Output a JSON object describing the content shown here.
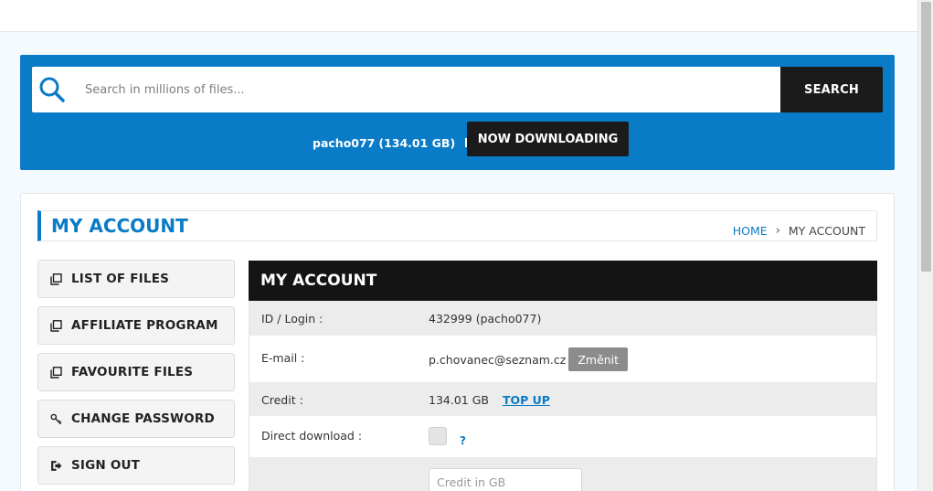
{
  "search": {
    "placeholder": "Search in millions of files...",
    "button_label": "SEARCH"
  },
  "user": {
    "name": "pacho077",
    "credit": "(134.01 GB)",
    "now_downloading_label": "NOW DOWNLOADING"
  },
  "page": {
    "title": "MY ACCOUNT",
    "breadcrumb": {
      "home": "HOME",
      "separator": "›",
      "current": "MY ACCOUNT"
    }
  },
  "sidebar": {
    "items": [
      {
        "label": "LIST OF FILES",
        "icon": "copy-icon"
      },
      {
        "label": "AFFILIATE PROGRAM",
        "icon": "copy-icon"
      },
      {
        "label": "FAVOURITE FILES",
        "icon": "copy-icon"
      },
      {
        "label": "CHANGE PASSWORD",
        "icon": "key-icon"
      },
      {
        "label": "SIGN OUT",
        "icon": "sign-out-icon"
      }
    ]
  },
  "account": {
    "heading": "MY ACCOUNT",
    "id_label": "ID / Login :",
    "id_value": "432999 (pacho077)",
    "email_label": "E-mail :",
    "email_value": "p.chovanec@seznam.cz",
    "email_change_label": "Změnit",
    "credit_label": "Credit :",
    "credit_value": "134.01 GB",
    "top_up_label": "TOP UP",
    "direct_download_label": "Direct download :",
    "direct_download_help": "?",
    "credit_input_placeholder": "Credit in GB"
  },
  "colors": {
    "accent": "#0a7bc6",
    "dark": "#141414",
    "row_gray": "#ececec"
  }
}
